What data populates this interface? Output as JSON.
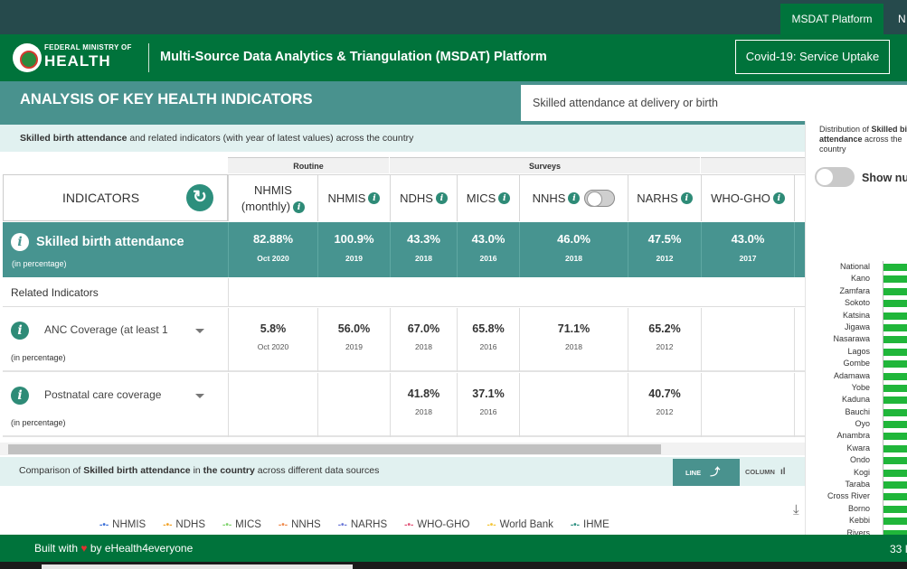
{
  "topbar": {
    "tabs": [
      "MSDAT Platform",
      "N"
    ]
  },
  "header": {
    "ministry": "FEDERAL MINISTRY OF",
    "health": "HEALTH",
    "app_title": "Multi-Source Data Analytics & Triangulation (MSDAT) Platform",
    "covid_button": "Covid-19: Service Uptake"
  },
  "analysis": {
    "title": "ANALYSIS OF KEY HEALTH INDICATORS",
    "selected_indicator": "Skilled attendance at delivery or birth"
  },
  "subtitle": {
    "bold": "Skilled birth attendance",
    "rest": " and related indicators (with year of latest values) across the country"
  },
  "table": {
    "groups": {
      "routine": "Routine",
      "surveys": "Surveys"
    },
    "indicators_header": "INDICATORS",
    "columns": [
      "NHMIS (monthly)",
      "NHMIS",
      "NDHS",
      "MICS",
      "NNHS",
      "NARHS",
      "WHO-GHO"
    ],
    "main": {
      "label": "Skilled birth attendance",
      "unit": "(in percentage)",
      "values": [
        {
          "v": "82.88%",
          "y": "Oct 2020"
        },
        {
          "v": "100.9%",
          "y": "2019"
        },
        {
          "v": "43.3%",
          "y": "2018"
        },
        {
          "v": "43.0%",
          "y": "2016"
        },
        {
          "v": "46.0%",
          "y": "2018"
        },
        {
          "v": "47.5%",
          "y": "2012"
        },
        {
          "v": "43.0%",
          "y": "2017"
        }
      ]
    },
    "related_label": "Related Indicators",
    "related": [
      {
        "name": "ANC Coverage (at least 1",
        "unit": "(in percentage)",
        "values": [
          {
            "v": "5.8%",
            "y": "Oct 2020"
          },
          {
            "v": "56.0%",
            "y": "2019"
          },
          {
            "v": "67.0%",
            "y": "2018"
          },
          {
            "v": "65.8%",
            "y": "2016"
          },
          {
            "v": "71.1%",
            "y": "2018"
          },
          {
            "v": "65.2%",
            "y": "2012"
          },
          {
            "v": "",
            "y": ""
          }
        ]
      },
      {
        "name": "Postnatal care coverage",
        "unit": "(in percentage)",
        "values": [
          {
            "v": "",
            "y": ""
          },
          {
            "v": "",
            "y": ""
          },
          {
            "v": "41.8%",
            "y": "2018"
          },
          {
            "v": "37.1%",
            "y": "2016"
          },
          {
            "v": "",
            "y": ""
          },
          {
            "v": "40.7%",
            "y": "2012"
          },
          {
            "v": "",
            "y": ""
          }
        ]
      }
    ]
  },
  "comparison": {
    "prefix": "Comparison of ",
    "indicator": "Skilled birth attendance",
    "middle": " in ",
    "scope": "the country",
    "suffix": " across different data sources",
    "line_label": "LINE",
    "column_label": "COLUMN"
  },
  "legend": [
    {
      "name": "NHMIS",
      "color": "#3a6fd8"
    },
    {
      "name": "NDHS",
      "color": "#f2a32a"
    },
    {
      "name": "MICS",
      "color": "#7ed36b"
    },
    {
      "name": "NNHS",
      "color": "#f08a4b"
    },
    {
      "name": "NARHS",
      "color": "#6b78d8"
    },
    {
      "name": "WHO-GHO",
      "color": "#e2567a"
    },
    {
      "name": "World Bank",
      "color": "#f4c63a"
    },
    {
      "name": "IHME",
      "color": "#2b8f80"
    }
  ],
  "right_panel": {
    "dist_prefix": "Distribution of ",
    "dist_bold": "Skilled birth attendance",
    "dist_suffix": " across the country",
    "show_label": "Show nu",
    "states": [
      "National",
      "Kano",
      "Zamfara",
      "Sokoto",
      "Katsina",
      "Jigawa",
      "Nasarawa",
      "Lagos",
      "Gombe",
      "Adamawa",
      "Yobe",
      "Kaduna",
      "Bauchi",
      "Oyo",
      "Anambra",
      "Kwara",
      "Ondo",
      "Kogi",
      "Taraba",
      "Cross River",
      "Borno",
      "Kebbi",
      "Rivers"
    ]
  },
  "footer": {
    "built_with": "Built with",
    "by": "by eHealth4everyone",
    "right": "33 I"
  },
  "colors": {
    "primary_green": "#00733b",
    "teal": "#49928e",
    "dark_bar": "#264a4c",
    "bar_green": "#20b63a"
  }
}
